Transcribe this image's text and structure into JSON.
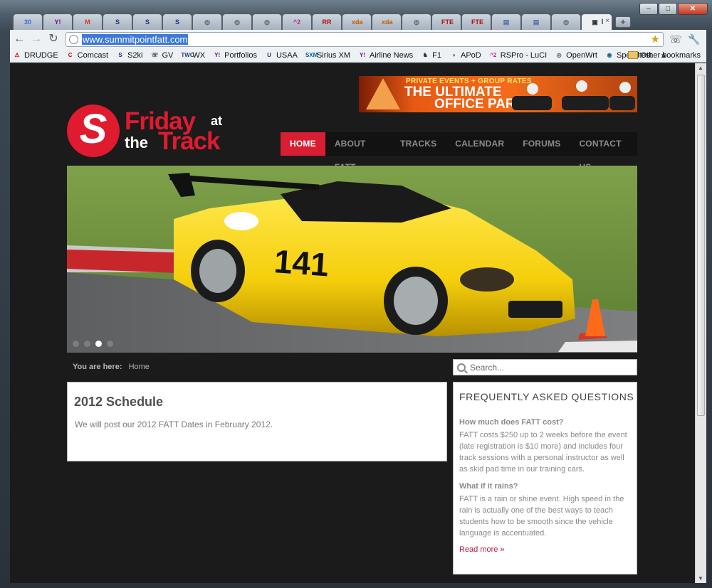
{
  "browser": {
    "tabs": [
      {
        "icon": "calendar-icon",
        "glyph": "30",
        "color": "#3b6fd4"
      },
      {
        "icon": "yahoo-icon",
        "glyph": "Y!",
        "color": "#7b0099"
      },
      {
        "icon": "gmail-icon",
        "glyph": "M",
        "color": "#d93025"
      },
      {
        "icon": "s2ki-icon",
        "glyph": "S",
        "color": "#1a2e8c"
      },
      {
        "icon": "s2ki-icon",
        "glyph": "S",
        "color": "#1a2e8c"
      },
      {
        "icon": "s2ki-icon",
        "glyph": "S",
        "color": "#1a2e8c"
      },
      {
        "icon": "globe-icon",
        "glyph": "◎",
        "color": "#555"
      },
      {
        "icon": "globe-icon",
        "glyph": "◎",
        "color": "#555"
      },
      {
        "icon": "globe-icon",
        "glyph": "◎",
        "color": "#555"
      },
      {
        "icon": "rspro-icon",
        "glyph": "^2",
        "color": "#c0249a"
      },
      {
        "icon": "red-square-icon",
        "glyph": "RR",
        "color": "#b01010"
      },
      {
        "icon": "xda-icon",
        "glyph": "xda",
        "color": "#c45a00"
      },
      {
        "icon": "xda-icon",
        "glyph": "xda",
        "color": "#c45a00"
      },
      {
        "icon": "globe-icon",
        "glyph": "◎",
        "color": "#555"
      },
      {
        "icon": "fte-icon",
        "glyph": "FTE",
        "color": "#b01010"
      },
      {
        "icon": "fte-icon",
        "glyph": "FTE",
        "color": "#b01010"
      },
      {
        "icon": "page-icon",
        "glyph": "▤",
        "color": "#4a6fa8"
      },
      {
        "icon": "page-icon",
        "glyph": "▤",
        "color": "#4a6fa8"
      },
      {
        "icon": "globe-icon",
        "glyph": "◎",
        "color": "#555"
      },
      {
        "icon": "site-icon",
        "glyph": "▣",
        "color": "#333",
        "active": true,
        "label": "I"
      }
    ],
    "url": "www.summitpointfatt.com",
    "bookmarks": [
      {
        "label": "DRUDGE",
        "glyph": "⚠",
        "color": "#c00"
      },
      {
        "label": "Comcast",
        "glyph": "C",
        "color": "#c00"
      },
      {
        "label": "S2ki",
        "glyph": "S",
        "color": "#1a2e8c"
      },
      {
        "label": "GV",
        "glyph": "☏",
        "color": "#555"
      },
      {
        "label": "WX",
        "glyph": "TWC",
        "color": "#1a3a8c"
      },
      {
        "label": "Portfolios",
        "glyph": "Y!",
        "color": "#7b0099"
      },
      {
        "label": "USAA",
        "glyph": "U",
        "color": "#1a2e5c"
      },
      {
        "label": "Sirius XM",
        "glyph": "SXM",
        "color": "#0060a0"
      },
      {
        "label": "Airline News",
        "glyph": "Y!",
        "color": "#7b0099"
      },
      {
        "label": "F1",
        "glyph": "♞",
        "color": "#333"
      },
      {
        "label": "APoD",
        "glyph": "◑",
        "color": "#333"
      },
      {
        "label": "RSPro - LuCI",
        "glyph": "^2",
        "color": "#c0249a"
      },
      {
        "label": "OpenWrt",
        "glyph": "◎",
        "color": "#555"
      },
      {
        "label": "Speedtest",
        "glyph": "◉",
        "color": "#1a6a8c"
      }
    ],
    "bookmarks_more": "»",
    "other_bookmarks": "Other bookmarks"
  },
  "ad": {
    "tagline": "PRIVATE EVENTS + GROUP RATES",
    "headline_1": "THE ULTIMATE",
    "headline_2": "OFFICE PARTY"
  },
  "logo": {
    "mark": "S",
    "word_friday": "Friday",
    "word_at": "at",
    "word_the": "the",
    "word_track": "Track"
  },
  "nav": [
    {
      "label": "HOME",
      "active": true
    },
    {
      "label": "ABOUT FATT"
    },
    {
      "label": "TRACKS"
    },
    {
      "label": "CALENDAR"
    },
    {
      "label": "FORUMS"
    },
    {
      "label": "CONTACT US"
    }
  ],
  "hero": {
    "car_number": "141",
    "slide_count": 4,
    "active_slide": 3
  },
  "breadcrumb": {
    "prefix": "You are here:",
    "current": "Home"
  },
  "search": {
    "placeholder": "Search..."
  },
  "article": {
    "title": "2012 Schedule",
    "body": "We will post our 2012 FATT Dates in February 2012."
  },
  "faq": {
    "title": "FREQUENTLY ASKED QUESTIONS",
    "items": [
      {
        "q": "How much does FATT cost?",
        "lines": [
          "FATT costs $250 up to 2 weeks before the event",
          "(late registration is $10 more) and includes four",
          "track sessions with a personal instructor as well",
          "as skid pad time in our training cars."
        ]
      },
      {
        "q": "What if it rains?",
        "lines": [
          "FATT is a rain or shine event.  High speed in the",
          "rain is actually one of the best ways to teach",
          "students how to be smooth since the vehicle",
          "language is accentuated."
        ]
      }
    ],
    "more": "Read more »"
  }
}
